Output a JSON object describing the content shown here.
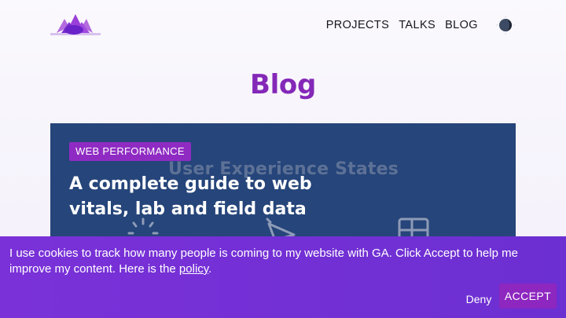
{
  "header": {
    "nav": [
      {
        "label": "PROJECTS"
      },
      {
        "label": "TALKS"
      },
      {
        "label": "BLOG"
      }
    ],
    "logo_icon": "lotus-logo-icon",
    "theme_toggle_icon": "moon-icon"
  },
  "page": {
    "title": "Blog"
  },
  "post": {
    "tag": "WEB PERFORMANCE",
    "title": "A complete guide to web vitals, lab and field data",
    "image_caption": "User Experience States",
    "image_icons": [
      "loading-spinner-icon",
      "cursor-click-icon",
      "layout-grid-icon"
    ]
  },
  "cookie_banner": {
    "text_before_link": "I use cookies to track how many people is coming to my website with GA. Click Accept to help me improve my content. Here is the ",
    "link_label": "policy",
    "text_after_link": ".",
    "deny_label": "Deny",
    "accept_label": "ACCEPT"
  },
  "colors": {
    "accent": "#8428b8",
    "card_bg": "#26457a",
    "tag_bg": "#8f2bc3",
    "banner_bg": "#7a31d8"
  }
}
